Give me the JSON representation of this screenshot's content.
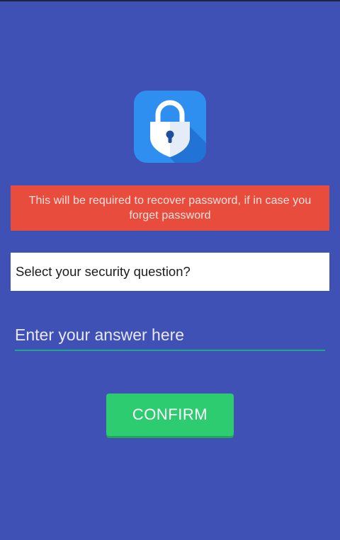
{
  "icon": {
    "name": "lock-icon",
    "background": "#2f8ff0",
    "shadow": "#1f6fd0",
    "shield": "#ffffff",
    "keyhole": "#1c4fa0"
  },
  "banner": {
    "text": "This will be required to recover password, if in case you forget password",
    "color": "#e84c3d"
  },
  "security_question": {
    "value": "Select your security question?"
  },
  "answer": {
    "placeholder": "Enter your answer here",
    "value": ""
  },
  "confirm": {
    "label": "CONFIRM",
    "color": "#2ecc71"
  },
  "theme": {
    "background": "#3f51b5",
    "underline": "#1fa68e"
  }
}
